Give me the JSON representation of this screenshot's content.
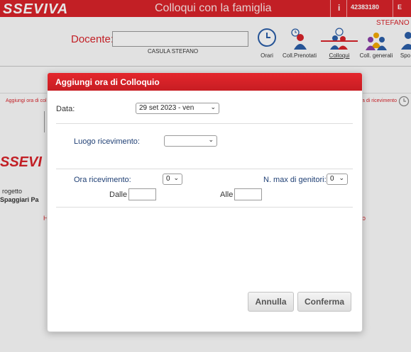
{
  "app": {
    "logo": "SSEVIVA",
    "title": "Colloqui con la famiglia",
    "info_icon": "info-icon",
    "code": "42383180",
    "corner_text": "E",
    "user_name": "STEFANO CA",
    "brand_color": "#d8232a"
  },
  "docente": {
    "label": "Docente:",
    "name": "CASULA STEFANO"
  },
  "nav": {
    "items": [
      {
        "label": "Orari",
        "icon": "clock-icon"
      },
      {
        "label": "Coll.Prenotati",
        "icon": "person-clock-icon"
      },
      {
        "label": "Colloqui",
        "icon": "people-chat-icon"
      },
      {
        "label": "Coll. generali",
        "icon": "group-people-icon"
      },
      {
        "label": "Spo",
        "icon": "person-icon"
      }
    ],
    "active_index": 2
  },
  "background": {
    "left_link": "Aggiungi ora di collo",
    "right_link": "a di ricevimento",
    "logo2": "SSEVI",
    "project_line1": "rogetto",
    "project_line2": "Spaggiari Pa",
    "h_text": "H",
    "o_text": "o"
  },
  "modal": {
    "title": "Aggiungi ora di Colloquio",
    "data_label": "Data:",
    "data_value": "29 set 2023 - ven",
    "luogo_label": "Luogo ricevimento:",
    "luogo_value": "",
    "ora_label": "Ora ricevimento:",
    "ora_value": "0",
    "max_label": "N. max di genitori:",
    "max_value": "0",
    "dalle_label": "Dalle",
    "alle_label": "Alle",
    "dalle_value": "",
    "alle_value": "",
    "cancel_label": "Annulla",
    "confirm_label": "Conferma"
  }
}
